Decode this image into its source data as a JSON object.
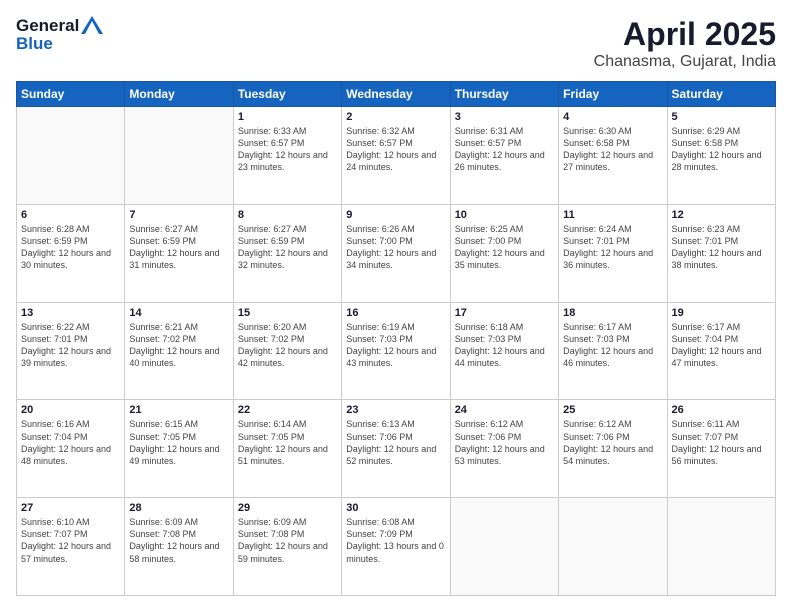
{
  "logo": {
    "general": "General",
    "blue": "Blue"
  },
  "title": "April 2025",
  "subtitle": "Chanasma, Gujarat, India",
  "days_header": [
    "Sunday",
    "Monday",
    "Tuesday",
    "Wednesday",
    "Thursday",
    "Friday",
    "Saturday"
  ],
  "weeks": [
    [
      {
        "day": "",
        "info": ""
      },
      {
        "day": "",
        "info": ""
      },
      {
        "day": "1",
        "info": "Sunrise: 6:33 AM\nSunset: 6:57 PM\nDaylight: 12 hours and 23 minutes."
      },
      {
        "day": "2",
        "info": "Sunrise: 6:32 AM\nSunset: 6:57 PM\nDaylight: 12 hours and 24 minutes."
      },
      {
        "day": "3",
        "info": "Sunrise: 6:31 AM\nSunset: 6:57 PM\nDaylight: 12 hours and 26 minutes."
      },
      {
        "day": "4",
        "info": "Sunrise: 6:30 AM\nSunset: 6:58 PM\nDaylight: 12 hours and 27 minutes."
      },
      {
        "day": "5",
        "info": "Sunrise: 6:29 AM\nSunset: 6:58 PM\nDaylight: 12 hours and 28 minutes."
      }
    ],
    [
      {
        "day": "6",
        "info": "Sunrise: 6:28 AM\nSunset: 6:59 PM\nDaylight: 12 hours and 30 minutes."
      },
      {
        "day": "7",
        "info": "Sunrise: 6:27 AM\nSunset: 6:59 PM\nDaylight: 12 hours and 31 minutes."
      },
      {
        "day": "8",
        "info": "Sunrise: 6:27 AM\nSunset: 6:59 PM\nDaylight: 12 hours and 32 minutes."
      },
      {
        "day": "9",
        "info": "Sunrise: 6:26 AM\nSunset: 7:00 PM\nDaylight: 12 hours and 34 minutes."
      },
      {
        "day": "10",
        "info": "Sunrise: 6:25 AM\nSunset: 7:00 PM\nDaylight: 12 hours and 35 minutes."
      },
      {
        "day": "11",
        "info": "Sunrise: 6:24 AM\nSunset: 7:01 PM\nDaylight: 12 hours and 36 minutes."
      },
      {
        "day": "12",
        "info": "Sunrise: 6:23 AM\nSunset: 7:01 PM\nDaylight: 12 hours and 38 minutes."
      }
    ],
    [
      {
        "day": "13",
        "info": "Sunrise: 6:22 AM\nSunset: 7:01 PM\nDaylight: 12 hours and 39 minutes."
      },
      {
        "day": "14",
        "info": "Sunrise: 6:21 AM\nSunset: 7:02 PM\nDaylight: 12 hours and 40 minutes."
      },
      {
        "day": "15",
        "info": "Sunrise: 6:20 AM\nSunset: 7:02 PM\nDaylight: 12 hours and 42 minutes."
      },
      {
        "day": "16",
        "info": "Sunrise: 6:19 AM\nSunset: 7:03 PM\nDaylight: 12 hours and 43 minutes."
      },
      {
        "day": "17",
        "info": "Sunrise: 6:18 AM\nSunset: 7:03 PM\nDaylight: 12 hours and 44 minutes."
      },
      {
        "day": "18",
        "info": "Sunrise: 6:17 AM\nSunset: 7:03 PM\nDaylight: 12 hours and 46 minutes."
      },
      {
        "day": "19",
        "info": "Sunrise: 6:17 AM\nSunset: 7:04 PM\nDaylight: 12 hours and 47 minutes."
      }
    ],
    [
      {
        "day": "20",
        "info": "Sunrise: 6:16 AM\nSunset: 7:04 PM\nDaylight: 12 hours and 48 minutes."
      },
      {
        "day": "21",
        "info": "Sunrise: 6:15 AM\nSunset: 7:05 PM\nDaylight: 12 hours and 49 minutes."
      },
      {
        "day": "22",
        "info": "Sunrise: 6:14 AM\nSunset: 7:05 PM\nDaylight: 12 hours and 51 minutes."
      },
      {
        "day": "23",
        "info": "Sunrise: 6:13 AM\nSunset: 7:06 PM\nDaylight: 12 hours and 52 minutes."
      },
      {
        "day": "24",
        "info": "Sunrise: 6:12 AM\nSunset: 7:06 PM\nDaylight: 12 hours and 53 minutes."
      },
      {
        "day": "25",
        "info": "Sunrise: 6:12 AM\nSunset: 7:06 PM\nDaylight: 12 hours and 54 minutes."
      },
      {
        "day": "26",
        "info": "Sunrise: 6:11 AM\nSunset: 7:07 PM\nDaylight: 12 hours and 56 minutes."
      }
    ],
    [
      {
        "day": "27",
        "info": "Sunrise: 6:10 AM\nSunset: 7:07 PM\nDaylight: 12 hours and 57 minutes."
      },
      {
        "day": "28",
        "info": "Sunrise: 6:09 AM\nSunset: 7:08 PM\nDaylight: 12 hours and 58 minutes."
      },
      {
        "day": "29",
        "info": "Sunrise: 6:09 AM\nSunset: 7:08 PM\nDaylight: 12 hours and 59 minutes."
      },
      {
        "day": "30",
        "info": "Sunrise: 6:08 AM\nSunset: 7:09 PM\nDaylight: 13 hours and 0 minutes."
      },
      {
        "day": "",
        "info": ""
      },
      {
        "day": "",
        "info": ""
      },
      {
        "day": "",
        "info": ""
      }
    ]
  ]
}
